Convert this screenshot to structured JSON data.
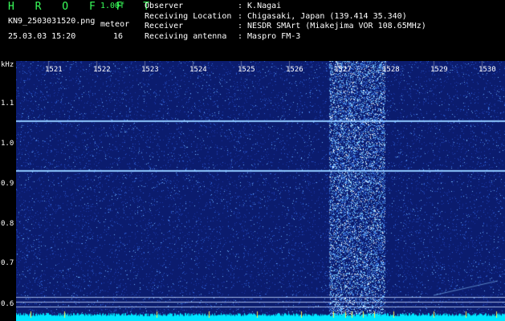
{
  "header": {
    "brand": "H R O F F T",
    "version": "1.00f",
    "filename": "KN9_2503031520.png",
    "meteor_label": "meteor",
    "datetime": "25.03.03 15:20",
    "meteor_count": "16",
    "meta": [
      {
        "key": "Observer",
        "value": ": K.Nagai"
      },
      {
        "key": "Receiving Location",
        "value": ": Chigasaki, Japan (139.414 35.340)"
      },
      {
        "key": "Receiver",
        "value": ": NESDR SMArt (Miakejima VOR 108.65MHz)"
      },
      {
        "key": "Receiving antenna",
        "value": ": Maspro FM-3"
      }
    ]
  },
  "spectrogram": {
    "freq_unit": "kHz",
    "freq_labels": [
      "1.1",
      "1.0",
      "0.9",
      "0.8",
      "0.7",
      "0.6"
    ],
    "time_labels": [
      "1521",
      "1522",
      "1523",
      "1524",
      "1525",
      "1526",
      "1527",
      "1528",
      "1529",
      "1530"
    ],
    "colors": {
      "background": "#0b1c6e",
      "signal": "#7fd0ff",
      "bright": "#ffffff",
      "level": "#00e5ff",
      "marker": "#ffe94a"
    }
  }
}
